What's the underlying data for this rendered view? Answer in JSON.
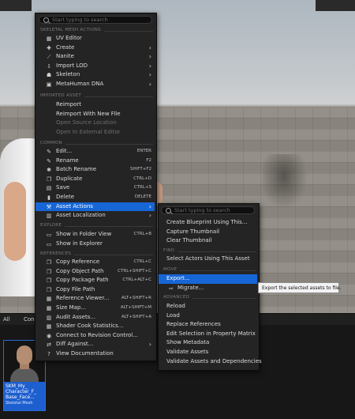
{
  "main_menu": {
    "search_placeholder": "Start typing to search",
    "sections": {
      "skeletal": "SKELETAL MESH ACTIONS",
      "imported": "IMPORTED ASSET",
      "common": "COMMON",
      "explore": "EXPLORE",
      "references": "REFERENCES"
    },
    "skeletal_items": [
      {
        "label": "UV Editor",
        "icon": "uv-icon",
        "glyph": "▦"
      },
      {
        "label": "Create",
        "icon": "create-icon",
        "glyph": "✚",
        "arrow": "›"
      },
      {
        "label": "Nanite",
        "icon": "nanite-icon",
        "glyph": "⟋",
        "arrow": "›"
      },
      {
        "label": "Import LOD",
        "icon": "import-lod-icon",
        "glyph": "⇩",
        "arrow": "›"
      },
      {
        "label": "Skeleton",
        "icon": "skeleton-icon",
        "glyph": "☗",
        "arrow": "›"
      },
      {
        "label": "MetaHuman DNA",
        "icon": "dna-icon",
        "glyph": "▣",
        "arrow": "›"
      }
    ],
    "imported_items": [
      {
        "label": "Reimport",
        "icon": "reimport-icon",
        "glyph": "",
        "disabled": false
      },
      {
        "label": "Reimport With New File",
        "icon": "reimport-new-icon",
        "glyph": "",
        "disabled": false
      },
      {
        "label": "Open Source Location",
        "icon": "folder-icon",
        "glyph": "",
        "disabled": true
      },
      {
        "label": "Open In External Editor",
        "icon": "external-icon",
        "glyph": "",
        "disabled": true
      }
    ],
    "common_items": [
      {
        "label": "Edit...",
        "icon": "edit-icon",
        "glyph": "✎",
        "shortcut": "ENTER"
      },
      {
        "label": "Rename",
        "icon": "rename-icon",
        "glyph": "✎",
        "shortcut": "F2"
      },
      {
        "label": "Batch Rename",
        "icon": "batch-rename-icon",
        "glyph": "✱",
        "shortcut": "SHIFT+F2"
      },
      {
        "label": "Duplicate",
        "icon": "duplicate-icon",
        "glyph": "❐",
        "shortcut": "CTRL+D"
      },
      {
        "label": "Save",
        "icon": "save-icon",
        "glyph": "▤",
        "shortcut": "CTRL+S"
      },
      {
        "label": "Delete",
        "icon": "delete-icon",
        "glyph": "▮",
        "shortcut": "DELETE"
      },
      {
        "label": "Asset Actions",
        "icon": "asset-actions-icon",
        "glyph": "⚒",
        "arrow": "›",
        "active": true
      },
      {
        "label": "Asset Localization",
        "icon": "localization-icon",
        "glyph": "▥",
        "arrow": "›"
      }
    ],
    "explore_items": [
      {
        "label": "Show in Folder View",
        "icon": "folder-view-icon",
        "glyph": "▭",
        "shortcut": "CTRL+B"
      },
      {
        "label": "Show in Explorer",
        "icon": "explorer-icon",
        "glyph": "▭"
      }
    ],
    "reference_items": [
      {
        "label": "Copy Reference",
        "icon": "copy-ref-icon",
        "glyph": "❐",
        "shortcut": "CTRL+C"
      },
      {
        "label": "Copy Object Path",
        "icon": "copy-object-icon",
        "glyph": "❐",
        "shortcut": "CTRL+SHIFT+C"
      },
      {
        "label": "Copy Package Path",
        "icon": "copy-package-icon",
        "glyph": "❐",
        "shortcut": "CTRL+ALT+C"
      },
      {
        "label": "Copy File Path",
        "icon": "copy-file-icon",
        "glyph": "❐"
      },
      {
        "label": "Reference Viewer...",
        "icon": "reference-viewer-icon",
        "glyph": "▦",
        "shortcut": "ALT+SHIFT+R"
      },
      {
        "label": "Size Map...",
        "icon": "size-map-icon",
        "glyph": "▦",
        "shortcut": "ALT+SHIFT+M"
      },
      {
        "label": "Audit Assets...",
        "icon": "audit-icon",
        "glyph": "▥",
        "shortcut": "ALT+SHIFT+A"
      },
      {
        "label": "Shader Cook Statistics...",
        "icon": "shader-icon",
        "glyph": "▦"
      },
      {
        "label": "Connect to Revision Control...",
        "icon": "revision-icon",
        "glyph": "◉"
      },
      {
        "label": "Diff Against...",
        "icon": "diff-icon",
        "glyph": "⇄",
        "arrow": "›"
      },
      {
        "label": "View Documentation",
        "icon": "docs-icon",
        "glyph": "?"
      }
    ]
  },
  "sub_menu": {
    "search_placeholder": "Start typing to search",
    "sections": {
      "find": "FIND",
      "move": "MOVE",
      "advanced": "ADVANCED"
    },
    "top_items": [
      {
        "label": "Create Blueprint Using This..."
      },
      {
        "label": "Capture Thumbnail"
      },
      {
        "label": "Clear Thumbnail"
      }
    ],
    "find_items": [
      {
        "label": "Select Actors Using This Asset"
      }
    ],
    "move_items": [
      {
        "label": "Export...",
        "active": true
      },
      {
        "label": "Migrate...",
        "icon": "migrate-icon",
        "glyph": "⇨"
      }
    ],
    "advanced_items": [
      {
        "label": "Reload"
      },
      {
        "label": "Load"
      },
      {
        "label": "Replace References"
      },
      {
        "label": "Edit Selection in Property Matrix"
      },
      {
        "label": "Show Metadata"
      },
      {
        "label": "Validate Assets"
      },
      {
        "label": "Validate Assets and Dependencies"
      }
    ]
  },
  "tooltip": "Export the selected assets to file.",
  "content_browser": {
    "tab_all": "All",
    "tab_partial": "Con",
    "asset": {
      "name": "SKM_My_ Character_F_ Base_Face...",
      "type": "Skeletal Mesh"
    }
  },
  "colors": {
    "accent": "#1766d6",
    "menu_bg": "#242424",
    "text": "#dcdcdc"
  }
}
